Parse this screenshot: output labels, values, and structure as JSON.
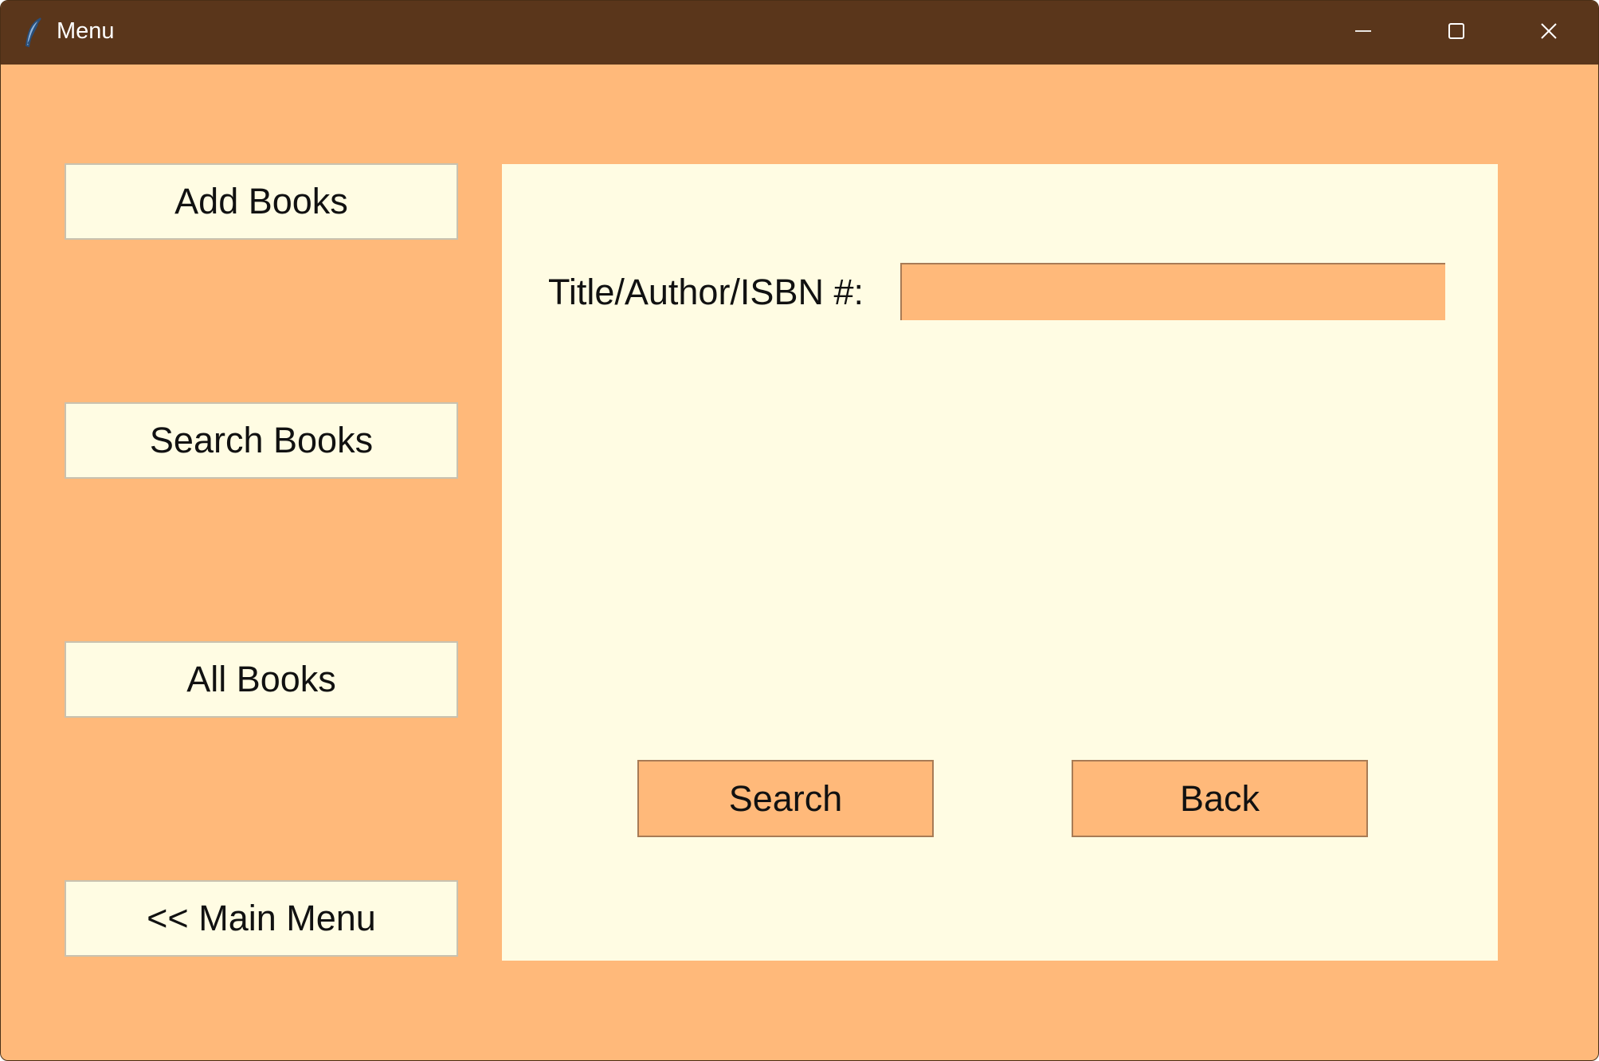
{
  "window": {
    "title": "Menu",
    "icon": "feather-icon",
    "controls": {
      "minimize_icon": "minimize-icon",
      "maximize_icon": "maximize-icon",
      "close_icon": "close-icon"
    }
  },
  "sidebar": {
    "items": [
      {
        "label": "Add Books"
      },
      {
        "label": "Search Books"
      },
      {
        "label": "All Books"
      },
      {
        "label": "<< Main Menu"
      }
    ]
  },
  "search_panel": {
    "field_label": "Title/Author/ISBN #:",
    "field_value": "",
    "search_label": "Search",
    "back_label": "Back"
  },
  "colors": {
    "titlebar": "#5a361b",
    "background": "#ffb97a",
    "panel": "#fffce3",
    "text": "#111111"
  }
}
